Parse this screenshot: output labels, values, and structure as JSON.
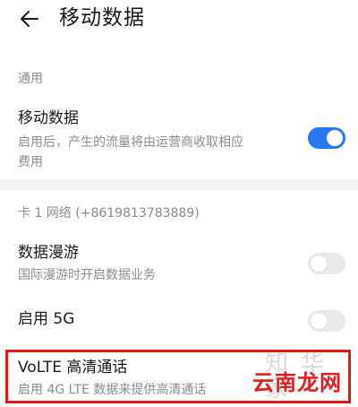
{
  "header": {
    "title": "移动数据",
    "back_icon": "arrow-left-icon"
  },
  "sections": {
    "general_label": "通用",
    "card_label": "卡 1 网络 (+8619813783889)"
  },
  "rows": {
    "mobile_data": {
      "title": "移动数据",
      "subtitle_line1": "启用后，产生的流量将由运营商收取相应",
      "subtitle_line2": "费用",
      "enabled": true
    },
    "roaming": {
      "title": "数据漫游",
      "subtitle": "国际漫游时开启数据业务",
      "enabled": false
    },
    "enable_5g": {
      "title": "启用 5G",
      "enabled": false
    },
    "volte": {
      "title": "VoLTE 高清通话",
      "subtitle": "启用 4G LTE 数据来提供高清通话"
    }
  },
  "watermark": {
    "logo_text": "云南龙网"
  },
  "colors": {
    "accent": "#2878f0",
    "highlight": "#e01818",
    "watermark": "#e02020"
  }
}
